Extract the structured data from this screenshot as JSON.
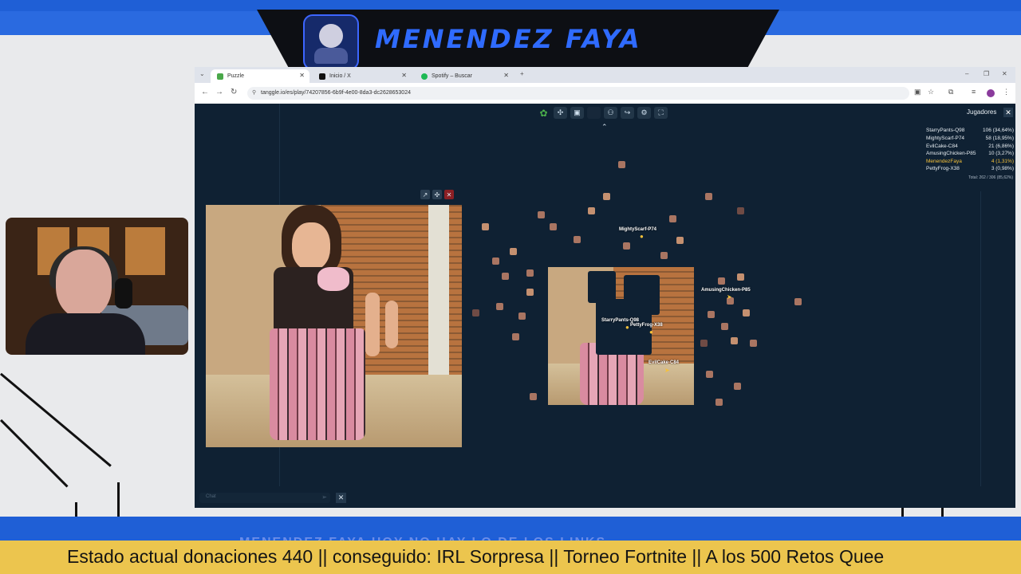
{
  "stream": {
    "title": "MENENDEZ FAYA",
    "bottom_faint": "MENENDEZ FAYA   HOY NO HAY LO DE LOS LINKS",
    "ticker": "Estado actual donaciones 440 || conseguido: IRL Sorpresa || Torneo Fortnite || A los 500 Retos Quee"
  },
  "browser": {
    "tabs": [
      {
        "label": "Puzzle",
        "icon": "tanggle-icon",
        "active": true
      },
      {
        "label": "Inicio / X",
        "icon": "x-logo-icon",
        "active": false
      },
      {
        "label": "Spotify – Buscar",
        "icon": "spotify-icon",
        "active": false
      }
    ],
    "url": "tanggle.io/es/play/74207856-6b9f-4e00-8da3-dc2628653024"
  },
  "game": {
    "players_title": "Jugadores",
    "players": [
      {
        "name": "StarryPants-Q98",
        "score": "106 (34,64%)"
      },
      {
        "name": "MightyScarf-P74",
        "score": "58 (18,95%)"
      },
      {
        "name": "EvilCake-C84",
        "score": "21 (6,86%)"
      },
      {
        "name": "AmusingChicken-P85",
        "score": "10 (3,27%)"
      },
      {
        "name": "MenendezFaya",
        "score": "4 (1,31%)"
      },
      {
        "name": "PettyFrog-X38",
        "score": "3 (0,98%)"
      }
    ],
    "total": "Total: 262 / 306 (85,62%)",
    "cursors": [
      "MightyScarf-P74",
      "AmusingChicken-P85",
      "StarryPants-Q98",
      "PettyFrog-X38",
      "EvilCake-C84"
    ],
    "chat_placeholder": "Chat",
    "highlight_color": "#f5c13a"
  }
}
